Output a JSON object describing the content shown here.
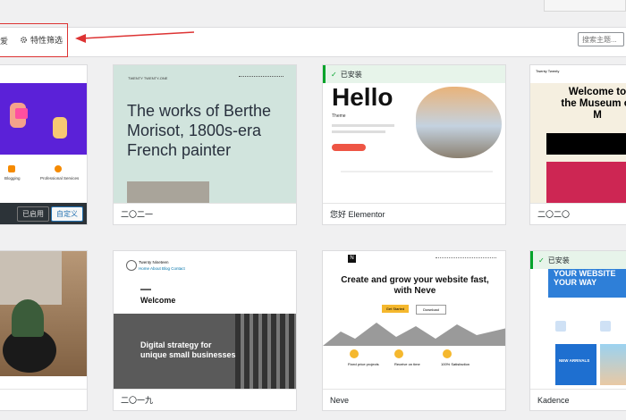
{
  "filter": {
    "left_fragment": "爱",
    "feature_label": "特性筛选",
    "search_placeholder": "搜索主题..."
  },
  "themes": [
    {
      "caption_active": "已启用",
      "caption_customize": "自定义",
      "mini_text_1": "Blogging",
      "mini_text_2": "Professional Services"
    },
    {
      "name": "二〇二一",
      "header_label": "TWENTY TWENTY-ONE",
      "headline": "The works of Berthe Morisot, 1800s-era French painter"
    },
    {
      "name": "您好 Elementor",
      "installed": "已安装",
      "hello": "Hello",
      "sub": "Theme"
    },
    {
      "name": "二〇二〇",
      "site": "Twenty Twenty",
      "headline": "Welcome to the Museum of M"
    },
    {
      "name": "二〇一九",
      "site": "Twenty Nineteen",
      "menu": "Home  About  Blog  Contact",
      "welcome": "Welcome",
      "digital": "Digital strategy for unique small businesses"
    },
    {
      "name": "Neve",
      "headline": "Create and grow your website fast, with Neve",
      "btn1": "Get Started",
      "btn2": "Download",
      "f1": "Fixed price projects",
      "f2": "Receive on time",
      "f3": "100% Satisfaction"
    },
    {
      "name": "Kadence",
      "installed": "已安装",
      "headline": "YOUR WEBSITE YOUR WAY",
      "arrivals": "NEW ARRIVALS"
    }
  ],
  "colors": {
    "accent": "#2271b1",
    "installed_green": "#00a32a",
    "annotation_red": "#d33"
  }
}
